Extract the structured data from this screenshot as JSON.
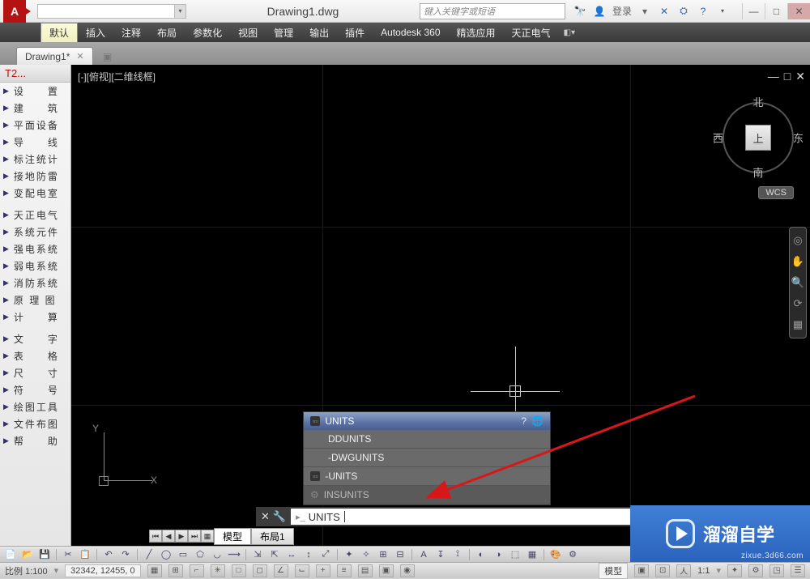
{
  "app": {
    "logo_letter": "A",
    "title": "Drawing1.dwg",
    "search_placeholder": "键入关键字或短语",
    "login_label": "登录"
  },
  "menu": {
    "items": [
      "默认",
      "插入",
      "注释",
      "布局",
      "参数化",
      "视图",
      "管理",
      "输出",
      "插件",
      "Autodesk 360",
      "精选应用",
      "天正电气"
    ],
    "active_index": 0
  },
  "doc_tabs": {
    "items": [
      "Drawing1*"
    ]
  },
  "sidebar": {
    "title": "T2...",
    "section1": [
      "设　　置",
      "建　　筑",
      "平面设备",
      "导　　线",
      "标注统计",
      "接地防雷",
      "变配电室"
    ],
    "section2": [
      "天正电气",
      "系统元件",
      "强电系统",
      "弱电系统",
      "消防系统",
      "原 理 图",
      "计　　算"
    ],
    "section3": [
      "文　　字",
      "表　　格",
      "尺　　寸",
      "符　　号",
      "绘图工具",
      "文件布图",
      "帮　　助"
    ]
  },
  "viewport": {
    "label": "[-][俯视][二维线框]",
    "compass": {
      "n": "北",
      "s": "南",
      "e": "东",
      "w": "西",
      "top": "上"
    },
    "wcs": "WCS"
  },
  "autocomplete": {
    "head": "UNITS",
    "items": [
      "DDUNITS",
      "-DWGUNITS"
    ],
    "sys": "-UNITS",
    "dim": "INSUNITS"
  },
  "commandline": {
    "value": "UNITS"
  },
  "model_tabs": {
    "items": [
      "模型",
      "布局1"
    ],
    "active_index": 0
  },
  "statusbar": {
    "scale_label": "比例 1:100",
    "coords": "32342, 12455, 0",
    "model_label": "模型",
    "anno_scale": "1:1"
  },
  "watermark": {
    "text": "溜溜自学",
    "url": "zixue.3d66.com"
  }
}
